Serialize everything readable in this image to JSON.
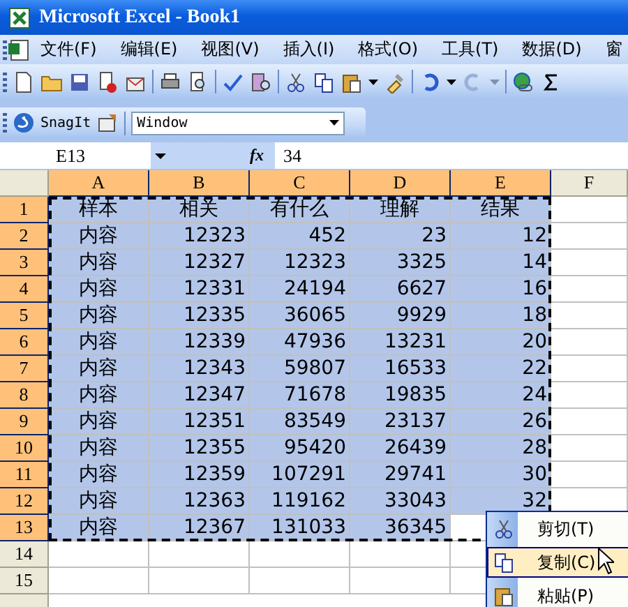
{
  "window": {
    "title": "Microsoft Excel - Book1"
  },
  "menu_bar": [
    "文件(F)",
    "编辑(E)",
    "视图(V)",
    "插入(I)",
    "格式(O)",
    "工具(T)",
    "数据(D)",
    "窗"
  ],
  "snagit_toolbar": {
    "label": "SnagIt",
    "dropdown": "Window"
  },
  "formula_bar": {
    "name_box": "E13",
    "function_label": "fx",
    "formula": "34"
  },
  "grid": {
    "marquee": true,
    "columns": [
      {
        "label": "A",
        "selected": true
      },
      {
        "label": "B",
        "selected": true
      },
      {
        "label": "C",
        "selected": true
      },
      {
        "label": "D",
        "selected": true
      },
      {
        "label": "E",
        "selected": true
      },
      {
        "label": "F",
        "selected": false
      }
    ],
    "rows": [
      {
        "number": "1",
        "selected": true,
        "kind": "header",
        "cells": [
          "样本",
          "相关",
          "有什么",
          "理解",
          "结果"
        ]
      },
      {
        "number": "2",
        "selected": true,
        "kind": "data",
        "cells": [
          "内容",
          "12323",
          "452",
          "23",
          "12"
        ]
      },
      {
        "number": "3",
        "selected": true,
        "kind": "data",
        "cells": [
          "内容",
          "12327",
          "12323",
          "3325",
          "14"
        ]
      },
      {
        "number": "4",
        "selected": true,
        "kind": "data",
        "cells": [
          "内容",
          "12331",
          "24194",
          "6627",
          "16"
        ]
      },
      {
        "number": "5",
        "selected": true,
        "kind": "data",
        "cells": [
          "内容",
          "12335",
          "36065",
          "9929",
          "18"
        ]
      },
      {
        "number": "6",
        "selected": true,
        "kind": "data",
        "cells": [
          "内容",
          "12339",
          "47936",
          "13231",
          "20"
        ]
      },
      {
        "number": "7",
        "selected": true,
        "kind": "data",
        "cells": [
          "内容",
          "12343",
          "59807",
          "16533",
          "22"
        ]
      },
      {
        "number": "8",
        "selected": true,
        "kind": "data",
        "cells": [
          "内容",
          "12347",
          "71678",
          "19835",
          "24"
        ]
      },
      {
        "number": "9",
        "selected": true,
        "kind": "data",
        "cells": [
          "内容",
          "12351",
          "83549",
          "23137",
          "26"
        ]
      },
      {
        "number": "10",
        "selected": true,
        "kind": "data",
        "cells": [
          "内容",
          "12355",
          "95420",
          "26439",
          "28"
        ]
      },
      {
        "number": "11",
        "selected": true,
        "kind": "data",
        "cells": [
          "内容",
          "12359",
          "107291",
          "29741",
          "30"
        ]
      },
      {
        "number": "12",
        "selected": true,
        "kind": "data",
        "cells": [
          "内容",
          "12363",
          "119162",
          "33043",
          "32"
        ]
      },
      {
        "number": "13",
        "selected": true,
        "kind": "data",
        "cells": [
          "内容",
          "12367",
          "131033",
          "36345"
        ]
      },
      {
        "number": "14",
        "selected": false,
        "kind": "data",
        "cells": []
      },
      {
        "number": "15",
        "selected": false,
        "kind": "data",
        "cells": []
      }
    ]
  },
  "context_menu": [
    {
      "label": "剪切(T)",
      "selected": false
    },
    {
      "label": "复制(C)",
      "selected": true
    },
    {
      "label": "粘贴(P)",
      "selected": false
    }
  ]
}
